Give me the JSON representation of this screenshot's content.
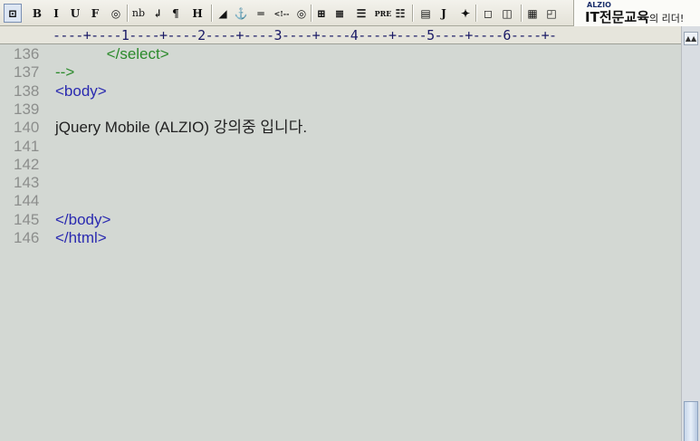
{
  "toolbar": {
    "buttons": [
      {
        "name": "preview-icon",
        "glyph": "⊡"
      },
      {
        "name": "bold-button",
        "glyph": "B"
      },
      {
        "name": "italic-button",
        "glyph": "I"
      },
      {
        "name": "underline-button",
        "glyph": "U"
      },
      {
        "name": "font-button",
        "glyph": "F"
      },
      {
        "name": "color-icon",
        "glyph": "◎"
      },
      {
        "name": "nbsp-button",
        "glyph": "nb"
      },
      {
        "name": "linebreak-button",
        "glyph": "↲"
      },
      {
        "name": "paragraph-button",
        "glyph": "¶"
      },
      {
        "name": "heading-button",
        "glyph": "H"
      },
      {
        "name": "link-icon",
        "glyph": "◢"
      },
      {
        "name": "anchor-icon",
        "glyph": "⚓"
      },
      {
        "name": "hr-button",
        "glyph": "═"
      },
      {
        "name": "comment-button",
        "glyph": "<!--"
      },
      {
        "name": "image-icon",
        "glyph": "◎"
      },
      {
        "name": "table-icon",
        "glyph": "⊞"
      },
      {
        "name": "align-center-icon",
        "glyph": "≣"
      },
      {
        "name": "align-icon",
        "glyph": "☰"
      },
      {
        "name": "pre-button",
        "glyph": "PRE"
      },
      {
        "name": "list-icon",
        "glyph": "☷"
      },
      {
        "name": "form-icon",
        "glyph": "▤"
      },
      {
        "name": "javascript-button",
        "glyph": "J"
      },
      {
        "name": "script-icon",
        "glyph": "✦"
      },
      {
        "name": "frame-icon",
        "glyph": "◻"
      },
      {
        "name": "frameset-icon",
        "glyph": "◫"
      },
      {
        "name": "color-palette-icon",
        "glyph": "▦"
      },
      {
        "name": "layout-icon",
        "glyph": "◰"
      }
    ]
  },
  "brand": {
    "small": "ALZIO",
    "main": "IT전문교육",
    "suffix": "의 리더!"
  },
  "ruler": {
    "text": "----+----1----+----2----+----3----+----4----+----5----+----6----+-"
  },
  "editor": {
    "lines": [
      {
        "num": "136",
        "code": "            </select>",
        "kind": "comment"
      },
      {
        "num": "137",
        "code": "-->",
        "kind": "comment"
      },
      {
        "num": "138",
        "code": "<body>",
        "kind": "tag"
      },
      {
        "num": "139",
        "code": "",
        "kind": "text"
      },
      {
        "num": "140",
        "code": "jQuery Mobile (ALZIO) 강의중 입니다.",
        "kind": "text"
      },
      {
        "num": "141",
        "code": "",
        "kind": "text"
      },
      {
        "num": "142",
        "code": "",
        "kind": "text"
      },
      {
        "num": "143",
        "code": "",
        "kind": "text"
      },
      {
        "num": "144",
        "code": "",
        "kind": "text"
      },
      {
        "num": "145",
        "code": "</body>",
        "kind": "tag"
      },
      {
        "num": "146",
        "code": "</html>",
        "kind": "tag"
      }
    ]
  },
  "scrollbar": {
    "up_glyph": "▲▲"
  }
}
